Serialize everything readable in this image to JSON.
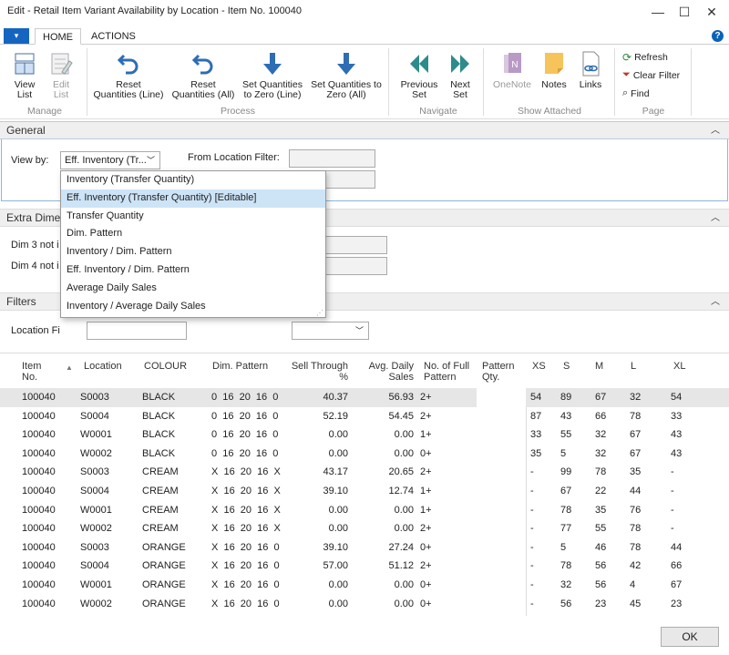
{
  "window": {
    "title": "Edit - Retail Item Variant Availability by Location - Item No. 100040",
    "minimize": "—",
    "maximize": "☐",
    "close": "✕"
  },
  "ribbon": {
    "menu_glyph": "▾",
    "help": "?",
    "tabs": [
      "HOME",
      "ACTIONS"
    ],
    "manage": {
      "label": "Manage",
      "view_list": [
        "View",
        "List"
      ],
      "edit_list": [
        "Edit",
        "List"
      ]
    },
    "process": {
      "label": "Process",
      "reset_line": [
        "Reset",
        "Quantities (Line)"
      ],
      "reset_all": [
        "Reset",
        "Quantities (All)"
      ],
      "zero_line": [
        "Set Quantities",
        "to Zero (Line)"
      ],
      "zero_all": [
        "Set Quantities to",
        "Zero (All)"
      ]
    },
    "navigate": {
      "label": "Navigate",
      "previous": [
        "Previous",
        "Set"
      ],
      "next": [
        "Next",
        "Set"
      ]
    },
    "show_attached": {
      "label": "Show Attached",
      "onenote": "OneNote",
      "notes": "Notes",
      "links": "Links"
    },
    "page": {
      "label": "Page",
      "refresh": "Refresh",
      "clear_filter": "Clear Filter",
      "find": "Find"
    }
  },
  "general": {
    "title": "General",
    "view_by_label": "View by:",
    "view_by_value": "Eff. Inventory (Tr...",
    "from_location_label": "From Location Filter:"
  },
  "dropdown": {
    "options": [
      "Inventory (Transfer Quantity)",
      "Eff. Inventory (Transfer Quantity) [Editable]",
      "Transfer Quantity",
      "Dim. Pattern",
      "Inventory / Dim. Pattern",
      "Eff. Inventory / Dim. Pattern",
      "Average Daily Sales",
      "Inventory / Average Daily Sales"
    ],
    "selected_index": 1
  },
  "extra": {
    "title": "Extra Dime",
    "dim3": "Dim 3 not i",
    "dim4": "Dim 4 not i"
  },
  "filters": {
    "title": "Filters",
    "location_label": "Location Fi"
  },
  "table": {
    "headers": {
      "item": [
        "Item",
        "No."
      ],
      "location": "Location",
      "colour": "COLOUR",
      "dim_pattern": "Dim. Pattern",
      "sell_through": [
        "Sell Through",
        "%"
      ],
      "avg_daily": [
        "Avg. Daily",
        "Sales"
      ],
      "full_pattern": [
        "No. of Full",
        "Pattern"
      ],
      "pattern_qty": [
        "Pattern",
        "Qty."
      ],
      "sizes": [
        "XS",
        "S",
        "M",
        "L",
        "XL"
      ]
    },
    "rows": [
      [
        "100040",
        "S0003",
        "BLACK",
        "0  16  20  16  0",
        "40.37",
        "56.93",
        "2+",
        "",
        "54",
        "89",
        "67",
        "32",
        "54"
      ],
      [
        "100040",
        "S0004",
        "BLACK",
        "0  16  20  16  0",
        "52.19",
        "54.45",
        "2+",
        "",
        "87",
        "43",
        "66",
        "78",
        "33"
      ],
      [
        "100040",
        "W0001",
        "BLACK",
        "0  16  20  16  0",
        "0.00",
        "0.00",
        "1+",
        "",
        "33",
        "55",
        "32",
        "67",
        "43"
      ],
      [
        "100040",
        "W0002",
        "BLACK",
        "0  16  20  16  0",
        "0.00",
        "0.00",
        "0+",
        "",
        "35",
        "5",
        "32",
        "67",
        "43"
      ],
      [
        "100040",
        "S0003",
        "CREAM",
        "X  16  20  16  X",
        "43.17",
        "20.65",
        "2+",
        "",
        "-",
        "99",
        "78",
        "35",
        "-"
      ],
      [
        "100040",
        "S0004",
        "CREAM",
        "X  16  20  16  X",
        "39.10",
        "12.74",
        "1+",
        "",
        "-",
        "67",
        "22",
        "44",
        "-"
      ],
      [
        "100040",
        "W0001",
        "CREAM",
        "X  16  20  16  X",
        "0.00",
        "0.00",
        "1+",
        "",
        "-",
        "78",
        "35",
        "76",
        "-"
      ],
      [
        "100040",
        "W0002",
        "CREAM",
        "X  16  20  16  X",
        "0.00",
        "0.00",
        "2+",
        "",
        "-",
        "77",
        "55",
        "78",
        "-"
      ],
      [
        "100040",
        "S0003",
        "ORANGE",
        "X  16  20  16  0",
        "39.10",
        "27.24",
        "0+",
        "",
        "-",
        "5",
        "46",
        "78",
        "44"
      ],
      [
        "100040",
        "S0004",
        "ORANGE",
        "X  16  20  16  0",
        "57.00",
        "51.12",
        "2+",
        "",
        "-",
        "78",
        "56",
        "42",
        "66"
      ],
      [
        "100040",
        "W0001",
        "ORANGE",
        "X  16  20  16  0",
        "0.00",
        "0.00",
        "0+",
        "",
        "-",
        "32",
        "56",
        "4",
        "67"
      ],
      [
        "100040",
        "W0002",
        "ORANGE",
        "X  16  20  16  0",
        "0.00",
        "0.00",
        "0+",
        "",
        "-",
        "56",
        "23",
        "45",
        "23"
      ]
    ]
  },
  "ok": "OK"
}
